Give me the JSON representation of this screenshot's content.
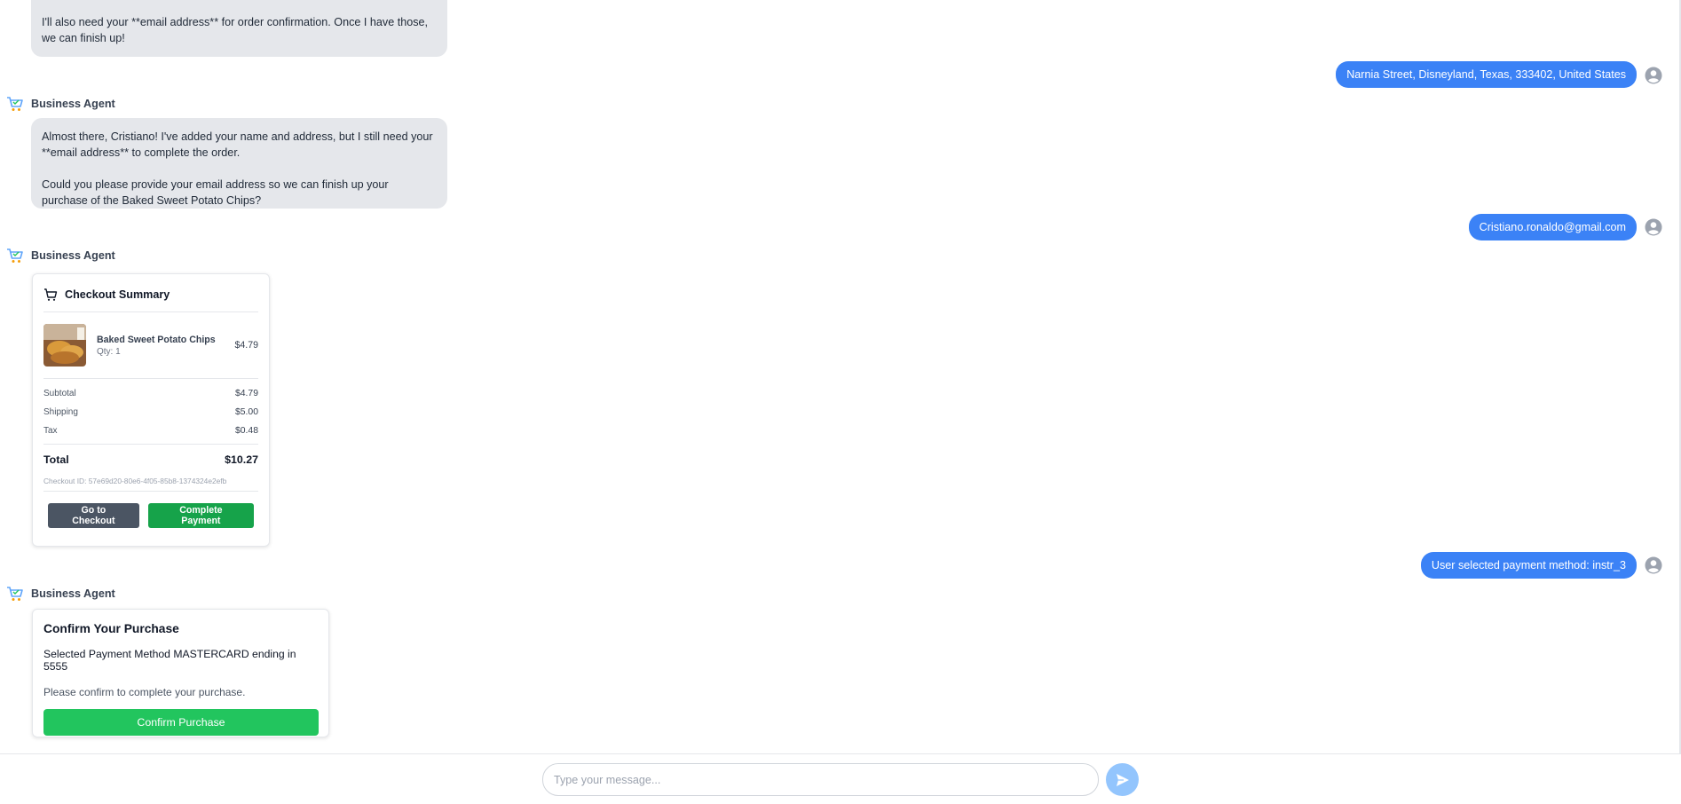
{
  "agent_name": "Business Agent",
  "messages": {
    "agent1": {
      "p1": "I'll also need your **email address** for order confirmation. Once I have those, we can finish up!"
    },
    "user1": "Narnia Street, Disneyland, Texas, 333402, United States",
    "agent2": {
      "p1": "Almost there, Cristiano! I've added your name and address, but I still need your **email address** to complete the order.",
      "p2": "Could you please provide your email address so we can finish up your purchase of the Baked Sweet Potato Chips?"
    },
    "user2": "Cristiano.ronaldo@gmail.com",
    "user3": "User selected payment method: instr_3"
  },
  "checkout": {
    "title": "Checkout Summary",
    "item": {
      "name": "Baked Sweet Potato Chips",
      "qty": "Qty: 1",
      "price": "$4.79"
    },
    "subtotal_label": "Subtotal",
    "subtotal": "$4.79",
    "shipping_label": "Shipping",
    "shipping": "$5.00",
    "tax_label": "Tax",
    "tax": "$0.48",
    "total_label": "Total",
    "total": "$10.27",
    "checkout_id": "Checkout ID: 57e69d20-80e6-4f05-85b8-1374324e2efb",
    "go_button": "Go to Checkout",
    "pay_button": "Complete Payment"
  },
  "confirm": {
    "title": "Confirm Your Purchase",
    "method": "Selected Payment Method MASTERCARD ending in 5555",
    "note": "Please confirm to complete your purchase.",
    "button": "Confirm Purchase"
  },
  "composer": {
    "placeholder": "Type your message..."
  },
  "icons": {
    "agent_avatar": "shopping-cart-icon",
    "user_avatar": "user-icon",
    "checkout_header": "cart-icon",
    "send": "send-icon"
  },
  "colors": {
    "user_bubble": "#3b82f6",
    "agent_bubble": "#e5e7eb",
    "confirm_button": "#22c55e",
    "pay_button": "#16a34a",
    "send_button": "#93c5fd"
  }
}
